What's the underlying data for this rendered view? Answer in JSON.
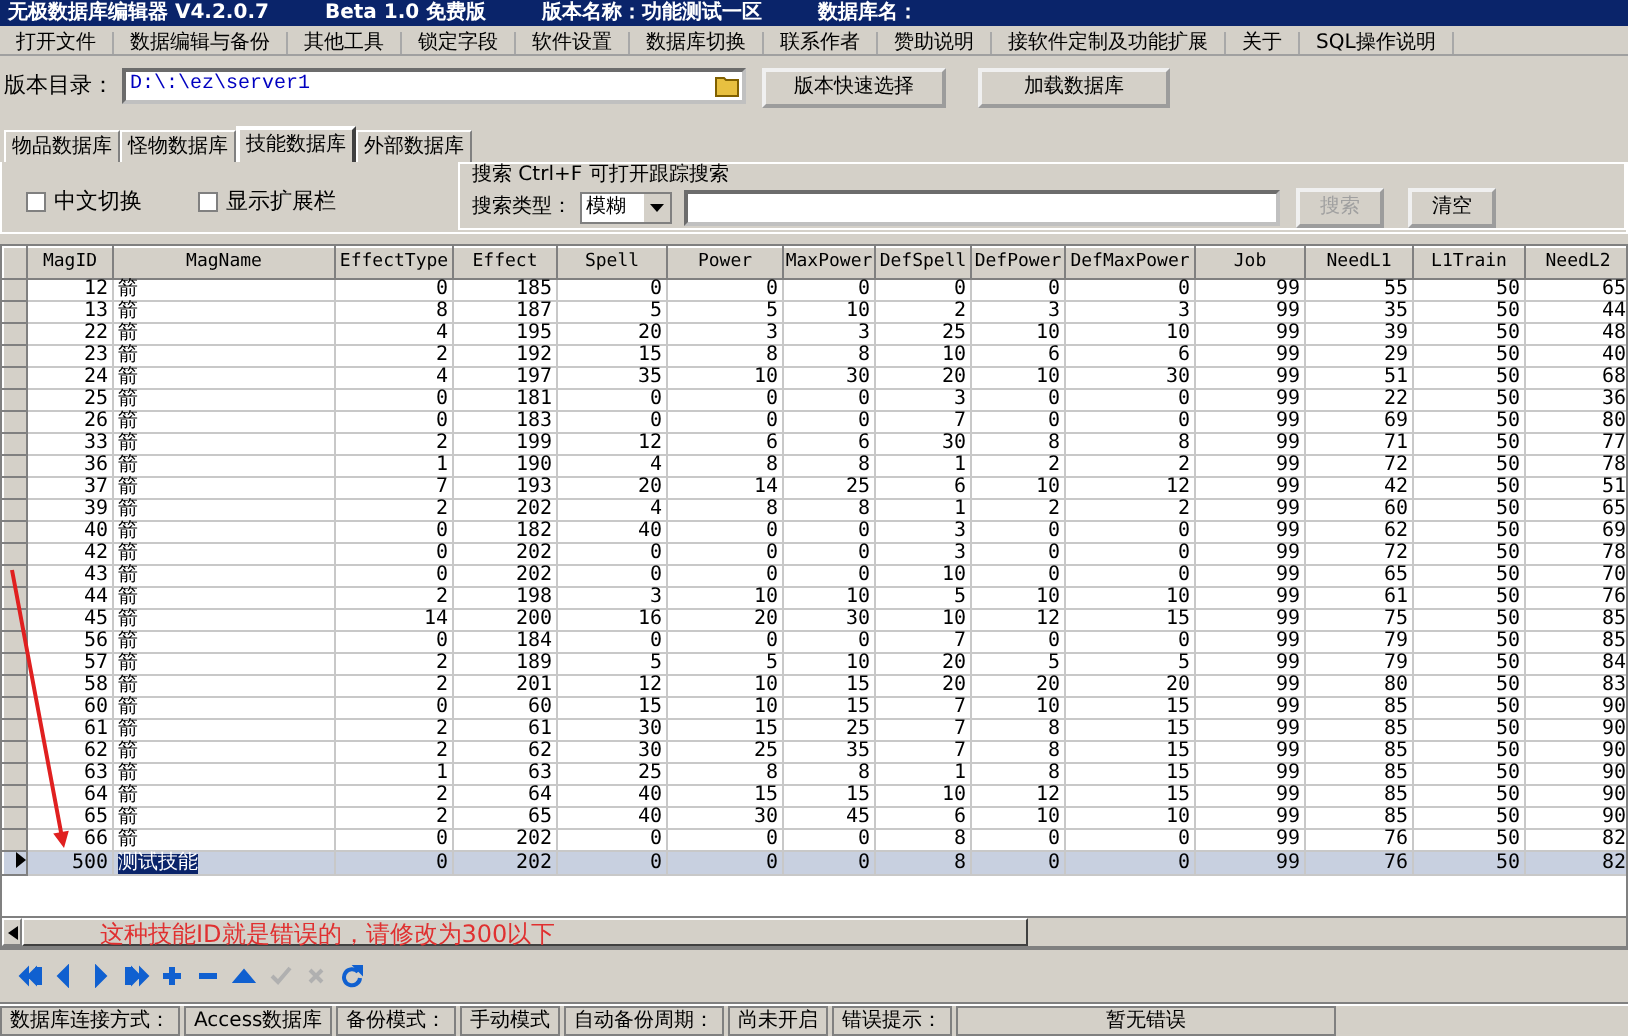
{
  "window": {
    "title": "无极数据库编辑器 V4.2.0.7",
    "edition": "Beta 1.0 免费版",
    "version_name": "版本名称：功能测试一区",
    "database_name": "数据库名："
  },
  "menu": [
    "打开文件",
    "数据编辑与备份",
    "其他工具",
    "锁定字段",
    "软件设置",
    "数据库切换",
    "联系作者",
    "赞助说明",
    "接软件定制及功能扩展",
    "关于",
    "SQL操作说明"
  ],
  "version_dir": {
    "label": "版本目录：",
    "value": "D:\\:\\ez\\server1",
    "buttons": [
      "版本快速选择",
      "加载数据库"
    ]
  },
  "tabs": [
    {
      "label": "物品数据库",
      "selected": false
    },
    {
      "label": "怪物数据库",
      "selected": false
    },
    {
      "label": "技能数据库",
      "selected": true
    },
    {
      "label": "外部数据库",
      "selected": false
    }
  ],
  "options": [
    {
      "label": "中文切换",
      "checked": false
    },
    {
      "label": "显示扩展栏",
      "checked": false
    }
  ],
  "search": {
    "title": "搜索  Ctrl+F 可打开跟踪搜索",
    "type_label": "搜索类型：",
    "type_value": "模糊",
    "buttons": [
      {
        "label": "搜索",
        "disabled": true
      },
      {
        "label": "清空",
        "disabled": false
      }
    ]
  },
  "table": {
    "columns": [
      "MagID",
      "MagName",
      "EffectType",
      "Effect",
      "Spell",
      "Power",
      "MaxPower",
      "DefSpell",
      "DefPower",
      "DefMaxPower",
      "Job",
      "NeedL1",
      "L1Train",
      "NeedL2"
    ],
    "rows": [
      {
        "selected": false,
        "cells": [
          "12",
          "箭",
          "0",
          "185",
          "0",
          "0",
          "0",
          "0",
          "0",
          "0",
          "99",
          "55",
          "50",
          "65"
        ]
      },
      {
        "selected": false,
        "cells": [
          "13",
          "箭",
          "8",
          "187",
          "5",
          "5",
          "10",
          "2",
          "3",
          "3",
          "99",
          "35",
          "50",
          "44"
        ]
      },
      {
        "selected": false,
        "cells": [
          "22",
          "箭",
          "4",
          "195",
          "20",
          "3",
          "3",
          "25",
          "10",
          "10",
          "99",
          "39",
          "50",
          "48"
        ]
      },
      {
        "selected": false,
        "cells": [
          "23",
          "箭",
          "2",
          "192",
          "15",
          "8",
          "8",
          "10",
          "6",
          "6",
          "99",
          "29",
          "50",
          "40"
        ]
      },
      {
        "selected": false,
        "cells": [
          "24",
          "箭",
          "4",
          "197",
          "35",
          "10",
          "30",
          "20",
          "10",
          "30",
          "99",
          "51",
          "50",
          "68"
        ]
      },
      {
        "selected": false,
        "cells": [
          "25",
          "箭",
          "0",
          "181",
          "0",
          "0",
          "0",
          "3",
          "0",
          "0",
          "99",
          "22",
          "50",
          "36"
        ]
      },
      {
        "selected": false,
        "cells": [
          "26",
          "箭",
          "0",
          "183",
          "0",
          "0",
          "0",
          "7",
          "0",
          "0",
          "99",
          "69",
          "50",
          "80"
        ]
      },
      {
        "selected": false,
        "cells": [
          "33",
          "箭",
          "2",
          "199",
          "12",
          "6",
          "6",
          "30",
          "8",
          "8",
          "99",
          "71",
          "50",
          "77"
        ]
      },
      {
        "selected": false,
        "cells": [
          "36",
          "箭",
          "1",
          "190",
          "4",
          "8",
          "8",
          "1",
          "2",
          "2",
          "99",
          "72",
          "50",
          "78"
        ]
      },
      {
        "selected": false,
        "cells": [
          "37",
          "箭",
          "7",
          "193",
          "20",
          "14",
          "25",
          "6",
          "10",
          "12",
          "99",
          "42",
          "50",
          "51"
        ]
      },
      {
        "selected": false,
        "cells": [
          "39",
          "箭",
          "2",
          "202",
          "4",
          "8",
          "8",
          "1",
          "2",
          "2",
          "99",
          "60",
          "50",
          "65"
        ]
      },
      {
        "selected": false,
        "cells": [
          "40",
          "箭",
          "0",
          "182",
          "40",
          "0",
          "0",
          "3",
          "0",
          "0",
          "99",
          "62",
          "50",
          "69"
        ]
      },
      {
        "selected": false,
        "cells": [
          "42",
          "箭",
          "0",
          "202",
          "0",
          "0",
          "0",
          "3",
          "0",
          "0",
          "99",
          "72",
          "50",
          "78"
        ]
      },
      {
        "selected": false,
        "cells": [
          "43",
          "箭",
          "0",
          "202",
          "0",
          "0",
          "0",
          "10",
          "0",
          "0",
          "99",
          "65",
          "50",
          "70"
        ]
      },
      {
        "selected": false,
        "cells": [
          "44",
          "箭",
          "2",
          "198",
          "3",
          "10",
          "10",
          "5",
          "10",
          "10",
          "99",
          "61",
          "50",
          "76"
        ]
      },
      {
        "selected": false,
        "cells": [
          "45",
          "箭",
          "14",
          "200",
          "16",
          "20",
          "30",
          "10",
          "12",
          "15",
          "99",
          "75",
          "50",
          "85"
        ]
      },
      {
        "selected": false,
        "cells": [
          "56",
          "箭",
          "0",
          "184",
          "0",
          "0",
          "0",
          "7",
          "0",
          "0",
          "99",
          "79",
          "50",
          "85"
        ]
      },
      {
        "selected": false,
        "cells": [
          "57",
          "箭",
          "2",
          "189",
          "5",
          "5",
          "10",
          "20",
          "5",
          "5",
          "99",
          "79",
          "50",
          "84"
        ]
      },
      {
        "selected": false,
        "cells": [
          "58",
          "箭",
          "2",
          "201",
          "12",
          "10",
          "15",
          "20",
          "20",
          "20",
          "99",
          "80",
          "50",
          "83"
        ]
      },
      {
        "selected": false,
        "cells": [
          "60",
          "箭",
          "0",
          "60",
          "15",
          "10",
          "15",
          "7",
          "10",
          "15",
          "99",
          "85",
          "50",
          "90"
        ]
      },
      {
        "selected": false,
        "cells": [
          "61",
          "箭",
          "2",
          "61",
          "30",
          "15",
          "25",
          "7",
          "8",
          "15",
          "99",
          "85",
          "50",
          "90"
        ]
      },
      {
        "selected": false,
        "cells": [
          "62",
          "箭",
          "2",
          "62",
          "30",
          "25",
          "35",
          "7",
          "8",
          "15",
          "99",
          "85",
          "50",
          "90"
        ]
      },
      {
        "selected": false,
        "cells": [
          "63",
          "箭",
          "1",
          "63",
          "25",
          "8",
          "8",
          "1",
          "8",
          "15",
          "99",
          "85",
          "50",
          "90"
        ]
      },
      {
        "selected": false,
        "cells": [
          "64",
          "箭",
          "2",
          "64",
          "40",
          "15",
          "15",
          "10",
          "12",
          "15",
          "99",
          "85",
          "50",
          "90"
        ]
      },
      {
        "selected": false,
        "cells": [
          "65",
          "箭",
          "2",
          "65",
          "40",
          "30",
          "45",
          "6",
          "10",
          "10",
          "99",
          "85",
          "50",
          "90"
        ]
      },
      {
        "selected": false,
        "cells": [
          "66",
          "箭",
          "0",
          "202",
          "0",
          "0",
          "0",
          "8",
          "0",
          "0",
          "99",
          "76",
          "50",
          "82"
        ]
      },
      {
        "selected": true,
        "cells": [
          "500",
          "测试技能",
          "0",
          "202",
          "0",
          "0",
          "0",
          "8",
          "0",
          "0",
          "99",
          "76",
          "50",
          "82"
        ]
      }
    ]
  },
  "annotation": {
    "text": "这种技能ID就是错误的，请修改为300以下"
  },
  "navigator": [
    {
      "kind": "first",
      "disabled": false
    },
    {
      "kind": "prior",
      "disabled": false
    },
    {
      "kind": "next",
      "disabled": false
    },
    {
      "kind": "last",
      "disabled": false
    },
    {
      "kind": "insert",
      "disabled": false
    },
    {
      "kind": "delete",
      "disabled": false
    },
    {
      "kind": "edit",
      "disabled": false
    },
    {
      "kind": "post",
      "disabled": true
    },
    {
      "kind": "cancel",
      "disabled": true
    },
    {
      "kind": "refresh",
      "disabled": false
    }
  ],
  "status_bar": [
    "数据库连接方式：",
    "Access数据库",
    "备份模式：",
    "手动模式",
    "自动备份周期：",
    "尚未开启",
    "错误提示：",
    "暂无错误"
  ]
}
